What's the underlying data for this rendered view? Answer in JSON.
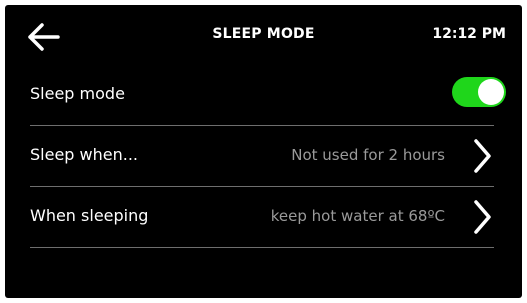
{
  "header": {
    "title": "SLEEP MODE",
    "time": "12:12 PM",
    "back_icon": "arrow-left-icon"
  },
  "settings": {
    "sleep_mode": {
      "label": "Sleep mode",
      "toggle_on": true,
      "toggle_color": "#1fd61b"
    },
    "sleep_when": {
      "label": "Sleep when...",
      "value": "Not used for 2 hours",
      "icon": "chevron-right-icon"
    },
    "when_sleeping": {
      "label": "When sleeping",
      "value": "keep hot water at 68ºC",
      "icon": "chevron-right-icon"
    }
  },
  "colors": {
    "background": "#000000",
    "text": "#ffffff",
    "secondary_text": "#9a9a9a",
    "divider": "#6e6e6e",
    "accent": "#1fd61b"
  }
}
